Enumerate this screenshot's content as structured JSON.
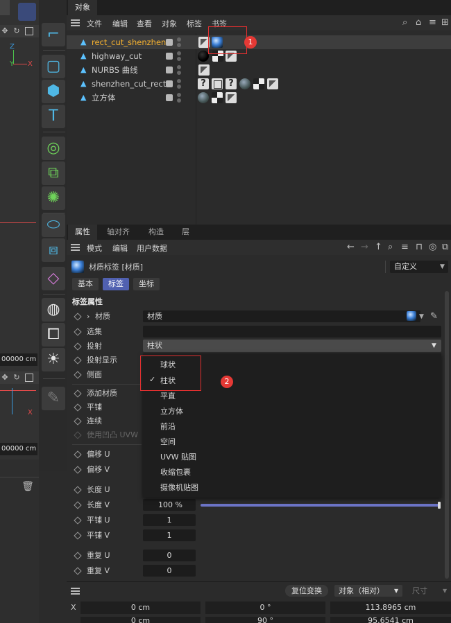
{
  "viewport": {
    "axis_z": "Z",
    "axis_y": "Y",
    "axis_x": "X",
    "field_top": "00000 cm",
    "field_bottom": "00000 cm"
  },
  "objects_panel": {
    "tab": "对象",
    "menu": [
      "文件",
      "编辑",
      "查看",
      "对象",
      "标签",
      "书签"
    ],
    "rows": [
      {
        "name": "rect_cut_shenzhen"
      },
      {
        "name": "highway_cut"
      },
      {
        "name": "NURBS 曲线"
      },
      {
        "name": "shenzhen_cut_rect"
      },
      {
        "name": "立方体"
      }
    ]
  },
  "attributes_panel": {
    "tabs": [
      "属性",
      "轴对齐",
      "构造",
      "层"
    ],
    "menu": [
      "模式",
      "编辑",
      "用户数据"
    ],
    "header_title": "材质标签 [材质]",
    "preset": "自定义",
    "section_tabs": [
      "基本",
      "标签",
      "坐标"
    ],
    "section_title": "标签属性",
    "material_label": "材质",
    "material_value": "材质",
    "selection_label": "选集",
    "projection_label": "投射",
    "projection_value": "柱状",
    "projection_display_label": "投射显示",
    "side_label": "侧面",
    "add_material_label": "添加材质",
    "tile_label": "平铺",
    "seamless_label": "连续",
    "use_bump_uvw_label": "使用凹凸 UVW",
    "offset_u_label": "偏移 U",
    "offset_v_label": "偏移 V",
    "length_u_label": "长度 U",
    "length_v_label": "长度 V",
    "length_v_value": "100 %",
    "length_v_fraction": 1.0,
    "tiles_u_label": "平铺 U",
    "tiles_u_value": "1",
    "tiles_v_label": "平铺 V",
    "tiles_v_value": "1",
    "repeat_u_label": "重复 U",
    "repeat_u_value": "0",
    "repeat_v_label": "重复 V",
    "repeat_v_value": "0",
    "dropdown_options": [
      "球状",
      "柱状",
      "平直",
      "立方体",
      "前沿",
      "空间",
      "UVW 贴图",
      "收缩包裹",
      "摄像机贴图"
    ],
    "dropdown_selected": "柱状"
  },
  "coords_panel": {
    "reset_button": "复位变换",
    "mode": "对象（相对）",
    "size_label": "尺寸",
    "row1_axis": "X",
    "row1_values": [
      "0 cm",
      "0 °",
      "113.8965 cm"
    ],
    "row2_values": [
      "0 cm",
      "90 °",
      "95.6541 cm"
    ]
  },
  "annotations": {
    "badge1": "1",
    "badge2": "2"
  },
  "colors": {
    "accent": "#5060b0",
    "highlight_name": "#f5b130",
    "annotation": "#e53935"
  }
}
